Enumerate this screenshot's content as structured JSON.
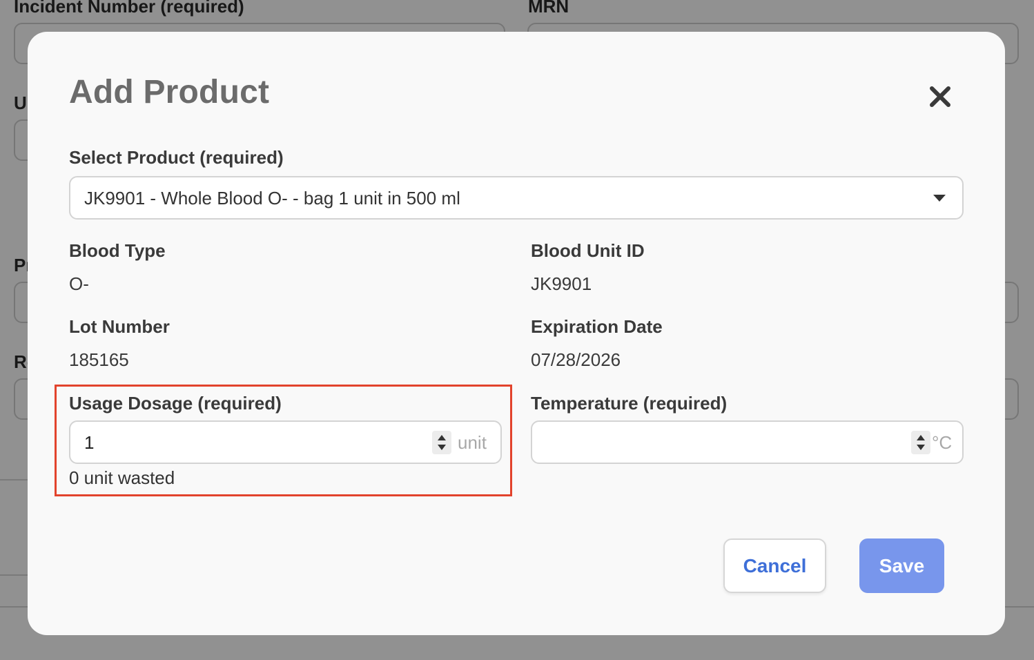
{
  "background": {
    "labels": {
      "incident_number": "Incident Number (required)",
      "mrn": "MRN",
      "u_fragment": "U",
      "p_fragment": "Pr",
      "r_fragment": "Re"
    }
  },
  "modal": {
    "title": "Add Product",
    "close_icon": "close-icon",
    "select_product": {
      "label": "Select Product (required)",
      "value": "JK9901 - Whole Blood O- - bag 1 unit in 500 ml"
    },
    "blood_type": {
      "label": "Blood Type",
      "value": "O-"
    },
    "blood_unit_id": {
      "label": "Blood Unit ID",
      "value": "JK9901"
    },
    "lot_number": {
      "label": "Lot Number",
      "value": "185165"
    },
    "expiration_date": {
      "label": "Expiration Date",
      "value": "07/28/2026"
    },
    "usage_dosage": {
      "label": "Usage Dosage (required)",
      "value": "1",
      "unit": "unit",
      "wasted_note": "0 unit wasted"
    },
    "temperature": {
      "label": "Temperature (required)",
      "value": "",
      "unit": "°C"
    },
    "buttons": {
      "cancel": "Cancel",
      "save": "Save"
    }
  },
  "colors": {
    "highlight_border": "#e2432c",
    "primary_button": "#7896ec",
    "link_blue": "#3e6fd8"
  }
}
